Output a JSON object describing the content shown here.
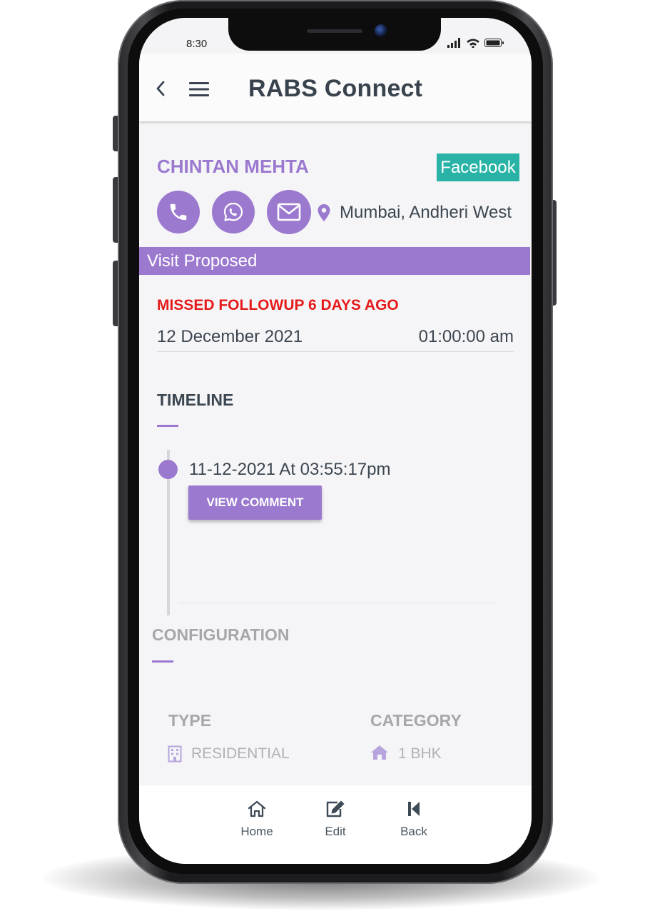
{
  "status_bar": {
    "time": "8:30"
  },
  "app_bar": {
    "title": "RABS Connect"
  },
  "lead": {
    "name": "CHINTAN MEHTA",
    "source": "Facebook",
    "location": "Mumbai, Andheri West",
    "status": "Visit Proposed"
  },
  "followup": {
    "missed_text": "MISSED FOLLOWUP 6 DAYS AGO",
    "date": "12 December 2021",
    "time": "01:00:00 am"
  },
  "timeline": {
    "title": "TIMELINE",
    "entries": [
      {
        "datetime": "11-12-2021 At 03:55:17pm",
        "button_label": "VIEW COMMENT"
      }
    ]
  },
  "configuration": {
    "title": "CONFIGURATION",
    "type_label": "TYPE",
    "type_value": "RESIDENTIAL",
    "category_label": "CATEGORY",
    "category_value": "1 BHK"
  },
  "bottom_nav": {
    "items": [
      {
        "label": "Home",
        "icon": "home-icon"
      },
      {
        "label": "Edit",
        "icon": "edit-icon"
      },
      {
        "label": "Back",
        "icon": "skip-back-icon"
      }
    ]
  },
  "colors": {
    "accent": "#9b79cf",
    "source_badge": "#28b3a6",
    "alert": "#e51b1b",
    "title_text": "#39434d"
  }
}
